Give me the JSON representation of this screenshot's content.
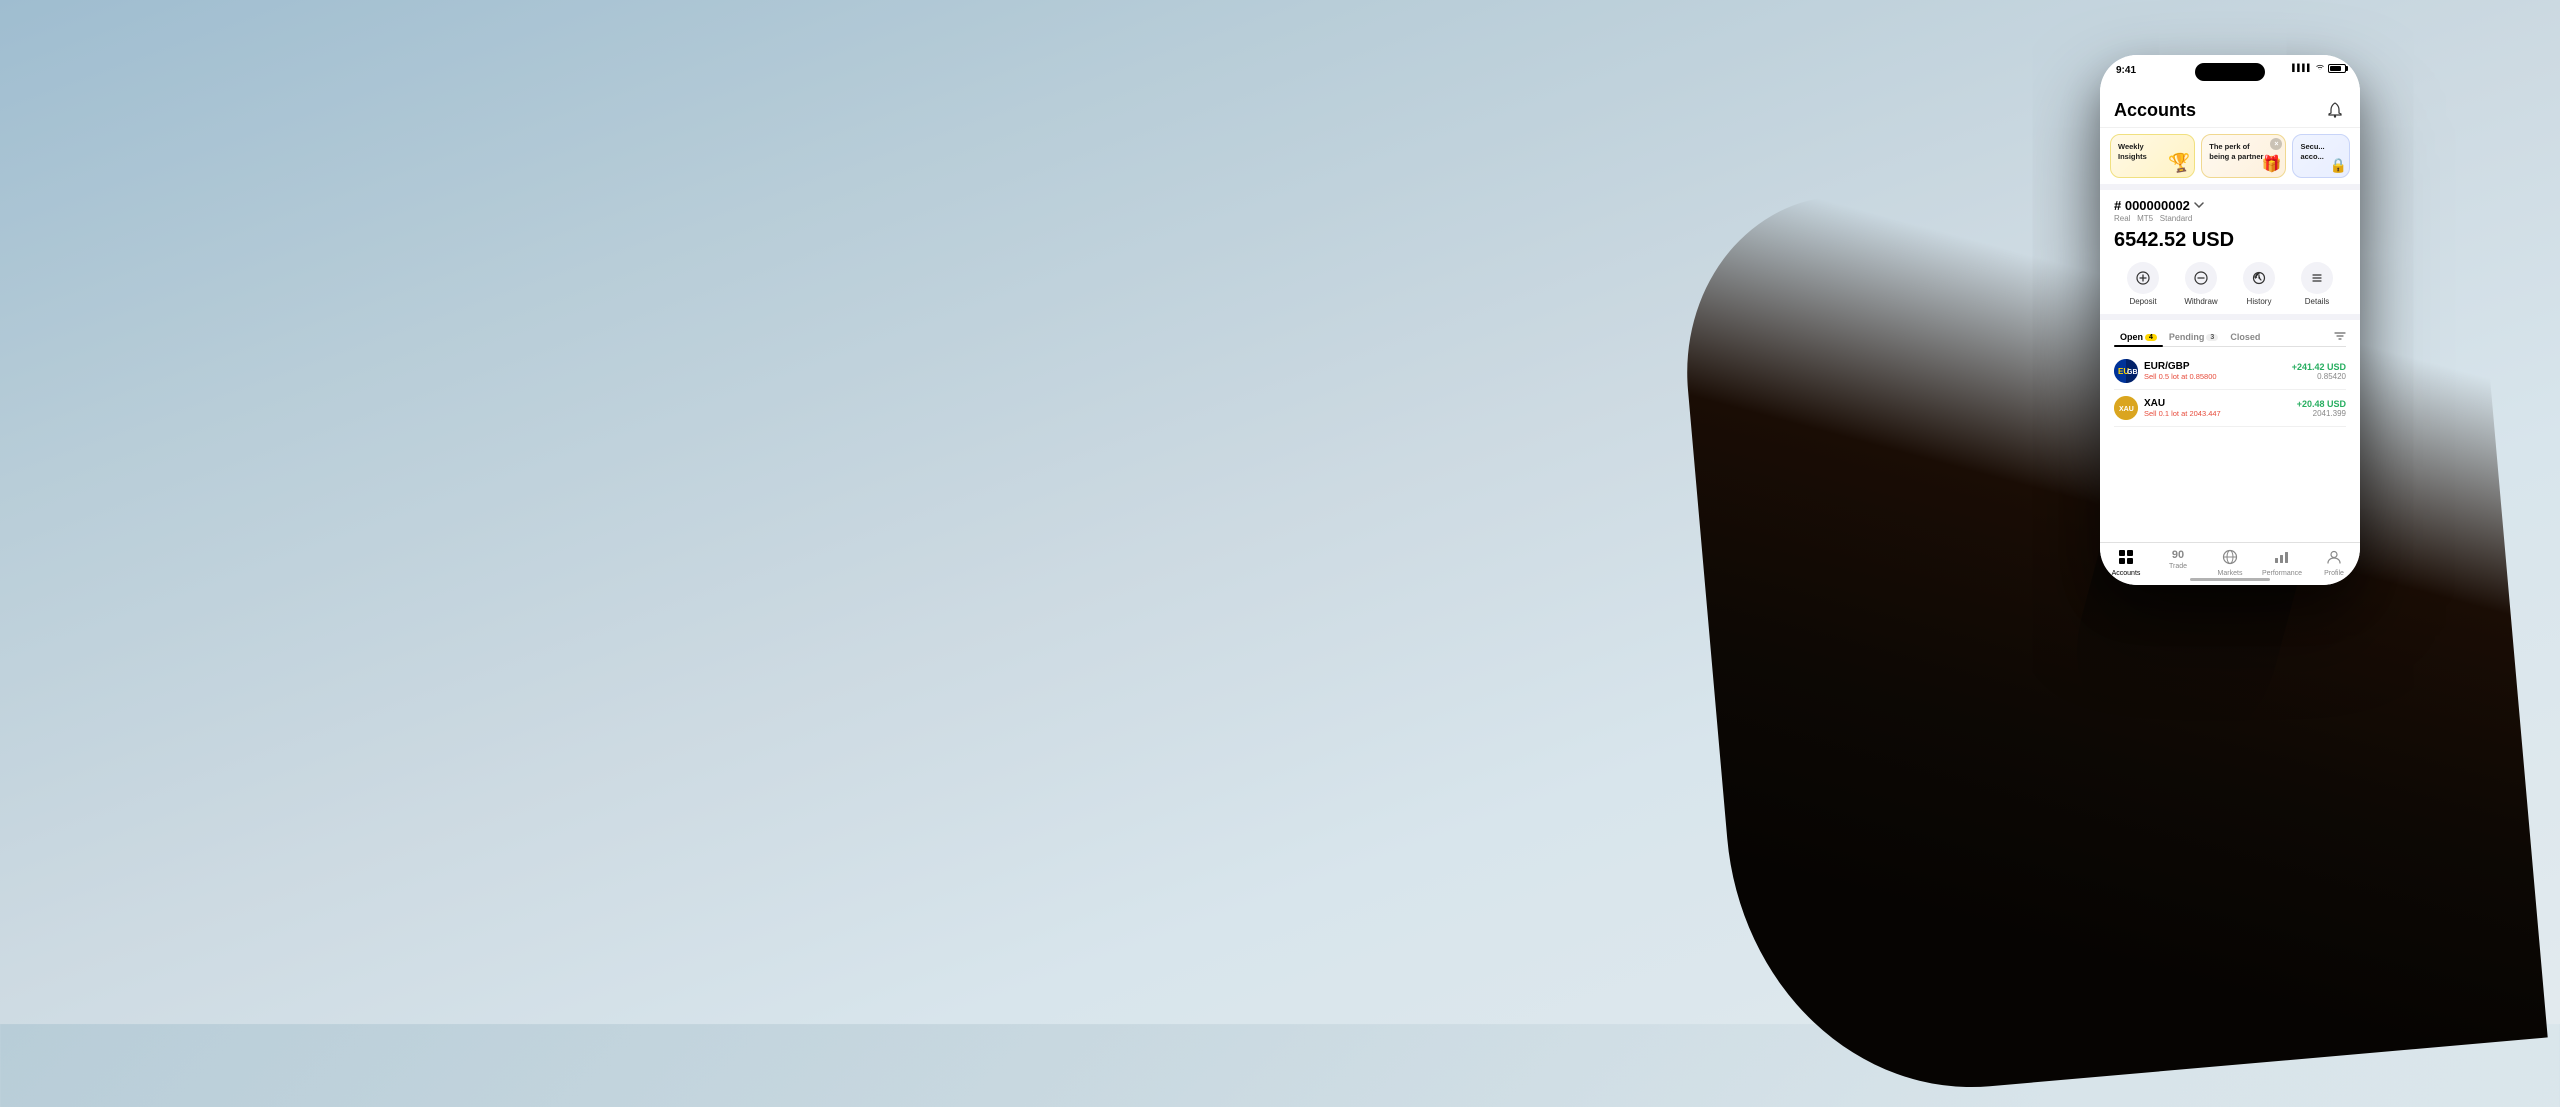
{
  "background": {
    "gradient_start": "#9fbdd0",
    "gradient_end": "#e2eaee"
  },
  "status_bar": {
    "time": "9:41",
    "signal_icon": "📶",
    "wifi_icon": "WiFi",
    "battery_icon": "🔋"
  },
  "app": {
    "title": "Accounts",
    "bell_label": "🔔"
  },
  "promo_cards": [
    {
      "id": "weekly",
      "label": "Weekly\nInsights",
      "icon": "🏆",
      "color": "yellow"
    },
    {
      "id": "partner",
      "label": "The perk of\nbeing a partner",
      "icon": "🎁",
      "color": "cream"
    },
    {
      "id": "secure",
      "label": "Secure\nacco...",
      "icon": "🔒",
      "color": "blue"
    }
  ],
  "account": {
    "number": "# 000000002",
    "type_real": "Real",
    "type_mt": "MT5",
    "type_plan": "Standard",
    "balance": "6542.52 USD"
  },
  "action_buttons": [
    {
      "id": "deposit",
      "icon": "⊕",
      "label": "Deposit"
    },
    {
      "id": "withdraw",
      "icon": "⊖",
      "label": "Withdraw"
    },
    {
      "id": "history",
      "icon": "⏱",
      "label": "History"
    },
    {
      "id": "details",
      "icon": "≡",
      "label": "Details"
    }
  ],
  "tabs": [
    {
      "id": "open",
      "label": "Open",
      "badge": "4",
      "active": true
    },
    {
      "id": "pending",
      "label": "Pending",
      "badge": "3",
      "active": false
    },
    {
      "id": "closed",
      "label": "Closed",
      "badge": "",
      "active": false
    }
  ],
  "trades": [
    {
      "id": "eurgbp",
      "pair": "EUR/GBP",
      "action": "Sell 0.5 lot at 0.85800",
      "profit": "+241.42 USD",
      "price": "0.85420",
      "flag_type": "eur-gbp"
    },
    {
      "id": "xau",
      "pair": "XAU",
      "action": "Sell 0.1 lot at 2043.447",
      "profit": "+20.48 USD",
      "price": "2041.399",
      "flag_type": "xau"
    }
  ],
  "bottom_nav": [
    {
      "id": "accounts",
      "icon": "⊞",
      "label": "Accounts",
      "active": true
    },
    {
      "id": "trade",
      "icon": "90",
      "label": "Trade",
      "active": false
    },
    {
      "id": "markets",
      "icon": "🌐",
      "label": "Markets",
      "active": false
    },
    {
      "id": "performance",
      "icon": "📊",
      "label": "Performance",
      "active": false
    },
    {
      "id": "profile",
      "icon": "👤",
      "label": "Profile",
      "active": false
    }
  ]
}
